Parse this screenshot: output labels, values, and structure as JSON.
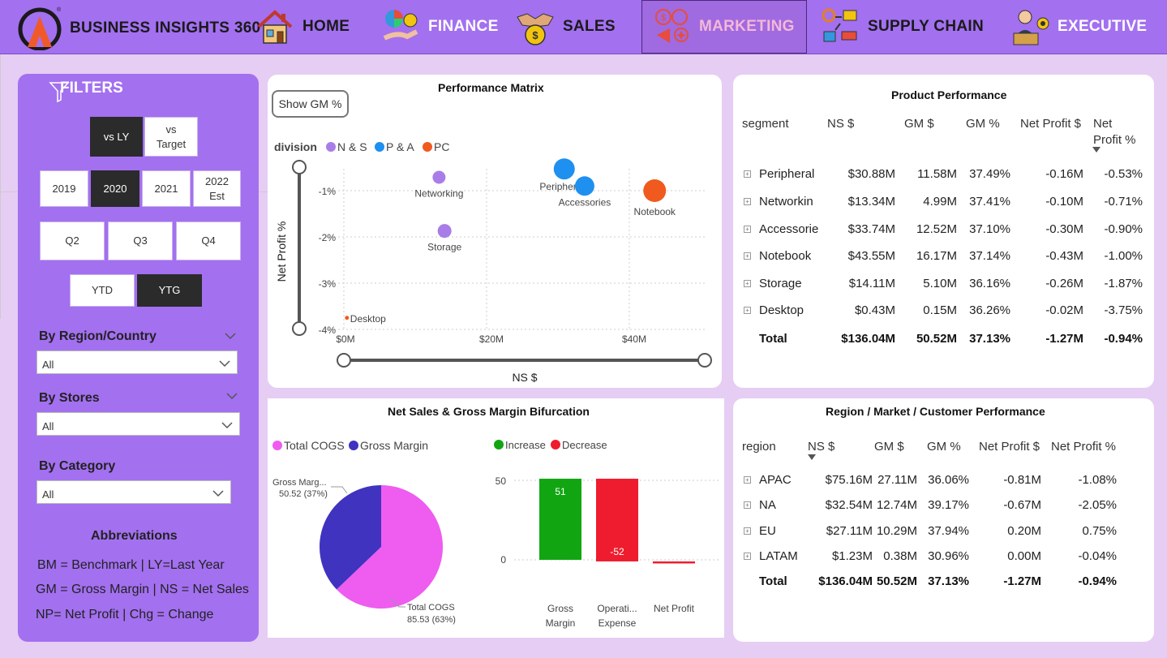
{
  "app": {
    "brand": "BUSINESS INSIGHTS 360"
  },
  "nav": [
    {
      "label": "HOME",
      "icon": "house-icon"
    },
    {
      "label": "FINANCE",
      "icon": "finance-icon"
    },
    {
      "label": "SALES",
      "icon": "handshake-coin-icon"
    },
    {
      "label": "MARKETING",
      "icon": "marketing-icon",
      "active": true
    },
    {
      "label": "SUPPLY CHAIN",
      "icon": "supply-chain-icon"
    },
    {
      "label": "EXECUTIVE",
      "icon": "executive-icon"
    }
  ],
  "filters": {
    "title": "FILTERS",
    "compare": [
      "vs LY",
      "vs Target"
    ],
    "years": [
      "2019",
      "2020",
      "2021",
      "2022 Est"
    ],
    "quarters": [
      "Q2",
      "Q3",
      "Q4"
    ],
    "period": [
      "YTD",
      "YTG"
    ],
    "region_label": "By Region/Country",
    "region_value": "All",
    "stores_label": "By Stores",
    "stores_value": "All",
    "category_label": "By Category",
    "category_value": "All",
    "abbr_title": "Abbreviations",
    "abbr": [
      "BM = Benchmark | LY=Last Year",
      "GM = Gross Margin | NS = Net Sales",
      "NP= Net Profit | Chg = Change"
    ]
  },
  "matrix": {
    "title": "Performance  Matrix",
    "toggle": "Show GM %",
    "legend_title": "division",
    "legend": [
      {
        "name": "N & S",
        "color": "#a97de8"
      },
      {
        "name": "P & A",
        "color": "#1e90f0"
      },
      {
        "name": "PC",
        "color": "#f05a1e"
      }
    ],
    "ylabel": "Net Profit %",
    "xlabel": "NS $",
    "yticks": [
      "-1%",
      "-2%",
      "-3%",
      "-4%"
    ],
    "xticks": [
      "$0M",
      "$20M",
      "$40M"
    ]
  },
  "chart_data": [
    {
      "type": "scatter",
      "title": "Performance  Matrix",
      "xlabel": "NS $",
      "ylabel": "Net Profit %",
      "ylim": [
        -4,
        -0.5
      ],
      "xlim": [
        0,
        50
      ],
      "points": [
        {
          "label": "Networking",
          "x": 13.34,
          "y": -0.71,
          "division": "N & S"
        },
        {
          "label": "Storage",
          "x": 14.11,
          "y": -1.87,
          "division": "N & S"
        },
        {
          "label": "Peripherals",
          "x": 30.88,
          "y": -0.53,
          "division": "P & A"
        },
        {
          "label": "Accessories",
          "x": 33.74,
          "y": -0.9,
          "division": "P & A"
        },
        {
          "label": "Notebook",
          "x": 43.55,
          "y": -1.0,
          "division": "PC"
        },
        {
          "label": "Desktop",
          "x": 0.43,
          "y": -3.75,
          "division": "PC"
        }
      ]
    },
    {
      "type": "pie",
      "title": "Net Sales  & Gross Margin Bifurcation",
      "slices": [
        {
          "name": "Total COGS",
          "value": 85.53,
          "pct": "63%",
          "color": "#ee5cf0"
        },
        {
          "name": "Gross Margin",
          "value": 50.52,
          "pct": "37%",
          "color": "#3f33c0"
        }
      ]
    },
    {
      "type": "bar",
      "subtype": "waterfall",
      "categories": [
        "Gross Margin",
        "Operati... Expense",
        "Net Profit"
      ],
      "values": [
        51,
        -52,
        -1.27
      ],
      "ylim": [
        0,
        50
      ],
      "legend": [
        {
          "name": "Increase",
          "color": "#11a611"
        },
        {
          "name": "Decrease",
          "color": "#ee1c2e"
        }
      ]
    }
  ],
  "pie": {
    "title": "Net Sales  & Gross Margin Bifurcation",
    "legend": [
      "Total COGS",
      "Gross Margin"
    ],
    "gm_label": "Gross Marg...",
    "gm_value": "50.52 (37%)",
    "cogs_label": "Total COGS",
    "cogs_value": "85.53 (63%)"
  },
  "waterfall": {
    "legend": [
      "Increase",
      "Decrease"
    ],
    "yticks": [
      "50",
      "0"
    ],
    "labels": [
      "51",
      "-52"
    ],
    "cats": [
      "Gross",
      "Margin",
      "Operati...",
      "Expense",
      "Net Profit"
    ]
  },
  "product": {
    "title": "Product Performance",
    "headers": [
      "segment",
      "NS $",
      "GM $",
      "GM %",
      "Net Profit $",
      "Net",
      "Profit %"
    ],
    "rows": [
      [
        "Peripheral",
        "$30.88M",
        "11.58M",
        "37.49%",
        "-0.16M",
        "-0.53%"
      ],
      [
        "Networkin",
        "$13.34M",
        "4.99M",
        "37.41%",
        "-0.10M",
        "-0.71%"
      ],
      [
        "Accessorie",
        "$33.74M",
        "12.52M",
        "37.10%",
        "-0.30M",
        "-0.90%"
      ],
      [
        "Notebook",
        "$43.55M",
        "16.17M",
        "37.14%",
        "-0.43M",
        "-1.00%"
      ],
      [
        "Storage",
        "$14.11M",
        "5.10M",
        "36.16%",
        "-0.26M",
        "-1.87%"
      ],
      [
        "Desktop",
        "$0.43M",
        "0.15M",
        "36.26%",
        "-0.02M",
        "-3.75%"
      ]
    ],
    "total": [
      "Total",
      "$136.04M",
      "50.52M",
      "37.13%",
      "-1.27M",
      "-0.94%"
    ]
  },
  "region": {
    "title": "Region / Market / Customer Performance",
    "headers": [
      "region",
      "NS $",
      "GM $",
      "GM %",
      "Net Profit $",
      "Net Profit %"
    ],
    "rows": [
      [
        "APAC",
        "$75.16M",
        "27.11M",
        "36.06%",
        "-0.81M",
        "-1.08%"
      ],
      [
        "NA",
        "$32.54M",
        "12.74M",
        "39.17%",
        "-0.67M",
        "-2.05%"
      ],
      [
        "EU",
        "$27.11M",
        "10.29M",
        "37.94%",
        "0.20M",
        "0.75%"
      ],
      [
        "LATAM",
        "$1.23M",
        "0.38M",
        "30.96%",
        "0.00M",
        "-0.04%"
      ]
    ],
    "total": [
      "Total",
      "$136.04M",
      "50.52M",
      "37.13%",
      "-1.27M",
      "-0.94%"
    ]
  }
}
